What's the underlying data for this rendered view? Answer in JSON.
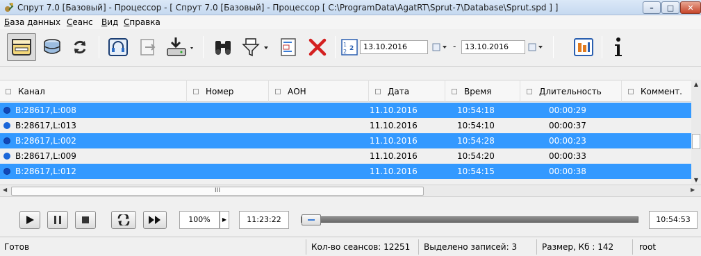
{
  "window": {
    "title": "Спрут 7.0 [Базовый] - Процессор - [ Спрут 7.0 [Базовый] - Процессор [ C:\\ProgramData\\AgatRT\\Sprut-7\\Database\\Sprut.spd ] ]"
  },
  "menu": {
    "items": [
      {
        "label_u": "Б",
        "label_rest": "аза данных"
      },
      {
        "label_u": "С",
        "label_rest": "еанс"
      },
      {
        "label_u": "В",
        "label_rest": "ид"
      },
      {
        "label_u": "С",
        "label_rest": "правка"
      }
    ]
  },
  "toolbar": {
    "date_from": "13.10.2016",
    "date_separator": "-",
    "date_to": "13.10.2016"
  },
  "table": {
    "columns": [
      "Канал",
      "Номер",
      "АОН",
      "Дата",
      "Время",
      "Длительность",
      "Коммент."
    ],
    "rows": [
      {
        "channel": "B:28617,L:008",
        "date": "11.10.2016",
        "time": "10:54:18",
        "duration": "00:00:29",
        "selected": true
      },
      {
        "channel": "B:28617,L:013",
        "date": "11.10.2016",
        "time": "10:54:10",
        "duration": "00:00:37",
        "selected": false
      },
      {
        "channel": "B:28617,L:002",
        "date": "11.10.2016",
        "time": "10:54:28",
        "duration": "00:00:23",
        "selected": true
      },
      {
        "channel": "B:28617,L:009",
        "date": "11.10.2016",
        "time": "10:54:20",
        "duration": "00:00:33",
        "selected": false
      },
      {
        "channel": "B:28617,L:012",
        "date": "11.10.2016",
        "time": "10:54:15",
        "duration": "00:00:38",
        "selected": true
      }
    ],
    "hscroll_grip": "III"
  },
  "player": {
    "speed": "100%",
    "current_time": "11:23:22",
    "position_fraction": 0,
    "end_time": "10:54:53"
  },
  "statusbar": {
    "state": "Готов",
    "sessions": "Кол-во сеансов: 12251",
    "selected": "Выделено записей: 3",
    "size": "Размер, Кб : 142",
    "user": "root"
  },
  "colors": {
    "selection": "#3399ff",
    "channel_dot": "#1a66d9",
    "delete_red": "#d42020"
  },
  "icons": [
    "app-icon",
    "database-open-icon",
    "database-stack-icon",
    "refresh-icon",
    "headphones-icon",
    "export-icon",
    "download-icon",
    "binoculars-icon",
    "filter-icon",
    "text-search-icon",
    "delete-icon",
    "sort-icon",
    "calendar-icon",
    "report-icon",
    "info-icon"
  ]
}
